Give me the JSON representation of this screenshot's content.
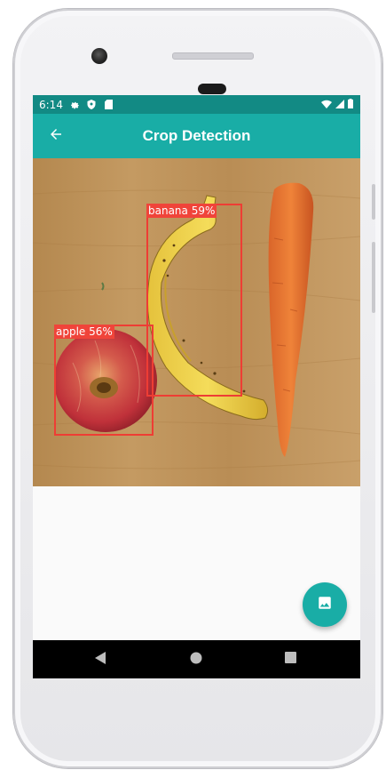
{
  "status_bar": {
    "time": "6:14",
    "left_icons": [
      "settings-icon",
      "shield-icon",
      "sd-card-icon"
    ],
    "right_icons": [
      "wifi-icon",
      "signal-icon",
      "battery-icon"
    ]
  },
  "app_bar": {
    "title": "Crop Detection",
    "back_icon": "arrow-back-icon",
    "color": "#19ada6"
  },
  "detections": [
    {
      "label": "banana 59%"
    },
    {
      "label": "apple 56%"
    }
  ],
  "fab": {
    "icon": "image-icon",
    "color": "#19ada6"
  },
  "nav_bar": {
    "buttons": [
      "back-triangle-icon",
      "home-circle-icon",
      "recents-square-icon"
    ]
  },
  "colors": {
    "box": "#ee3d34",
    "status_bar": "#128a84"
  }
}
